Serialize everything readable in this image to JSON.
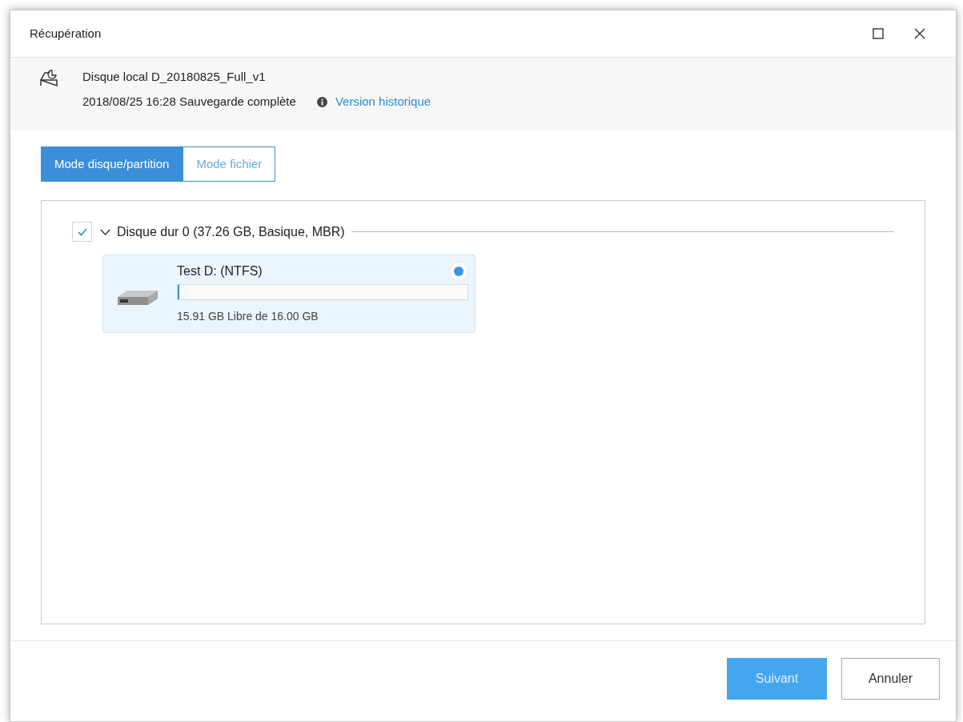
{
  "window": {
    "title": "Récupération"
  },
  "backup": {
    "name": "Disque local D_20180825_Full_v1",
    "info": "2018/08/25 16:28 Sauvegarde complète",
    "link": "Version historique"
  },
  "tabs": [
    {
      "label": "Mode disque/partition",
      "selected": true
    },
    {
      "label": "Mode fichier",
      "selected": false
    }
  ],
  "disks": [
    {
      "label": "Disque dur 0 (37.26 GB, Basique, MBR)",
      "checked": true,
      "expanded": true,
      "partitions": [
        {
          "name": "Test D: (NTFS)",
          "selected": true,
          "level": 0.006,
          "free": "15.91 GB Libre de 16.00 GB"
        }
      ]
    }
  ],
  "buttons": [
    {
      "label": "Suivant",
      "kind": "primary"
    },
    {
      "label": "Annuler",
      "kind": "secondary"
    }
  ]
}
